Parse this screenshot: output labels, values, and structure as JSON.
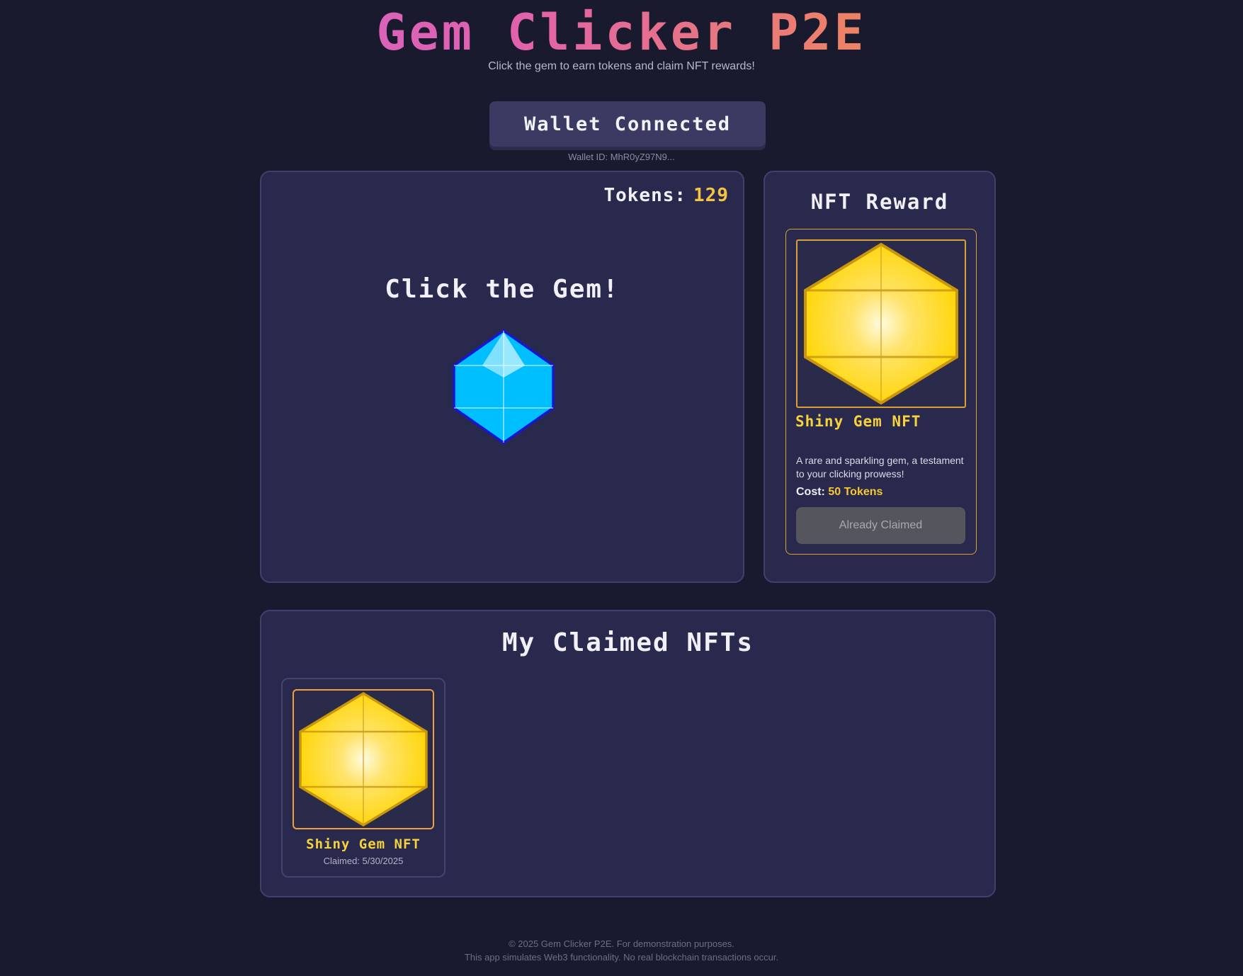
{
  "header": {
    "title": "Gem Clicker P2E",
    "subtitle": "Click the gem to earn tokens and claim NFT rewards!"
  },
  "wallet": {
    "button_label": "Wallet Connected",
    "id_text": "Wallet ID: MhR0yZ97N9..."
  },
  "game": {
    "tokens_label": "Tokens:",
    "tokens_value": "129",
    "prompt": "Click the Gem!",
    "gem_icon": "blue-gem-icon"
  },
  "reward": {
    "heading": "NFT Reward",
    "nft_name": "Shiny Gem NFT",
    "description": "A rare and sparkling gem, a testament to your clicking prowess!",
    "cost_label": "Cost:",
    "cost_value": "50 Tokens",
    "button_label": "Already Claimed",
    "image_icon": "golden-gem-icon"
  },
  "claimed": {
    "heading": "My Claimed NFTs",
    "items": [
      {
        "name": "Shiny Gem NFT",
        "date": "Claimed: 5/30/2025",
        "image_icon": "golden-gem-icon"
      }
    ]
  },
  "footer": {
    "line1": "© 2025 Gem Clicker P2E. For demonstration purposes.",
    "line2": "This app simulates Web3 functionality. No real blockchain transactions occur."
  },
  "colors": {
    "background": "#1a1a2e",
    "panel": "#29294d",
    "token_gold": "#f5c542",
    "nft_gold": "#ffd700",
    "gem_blue": "#00bfff"
  }
}
